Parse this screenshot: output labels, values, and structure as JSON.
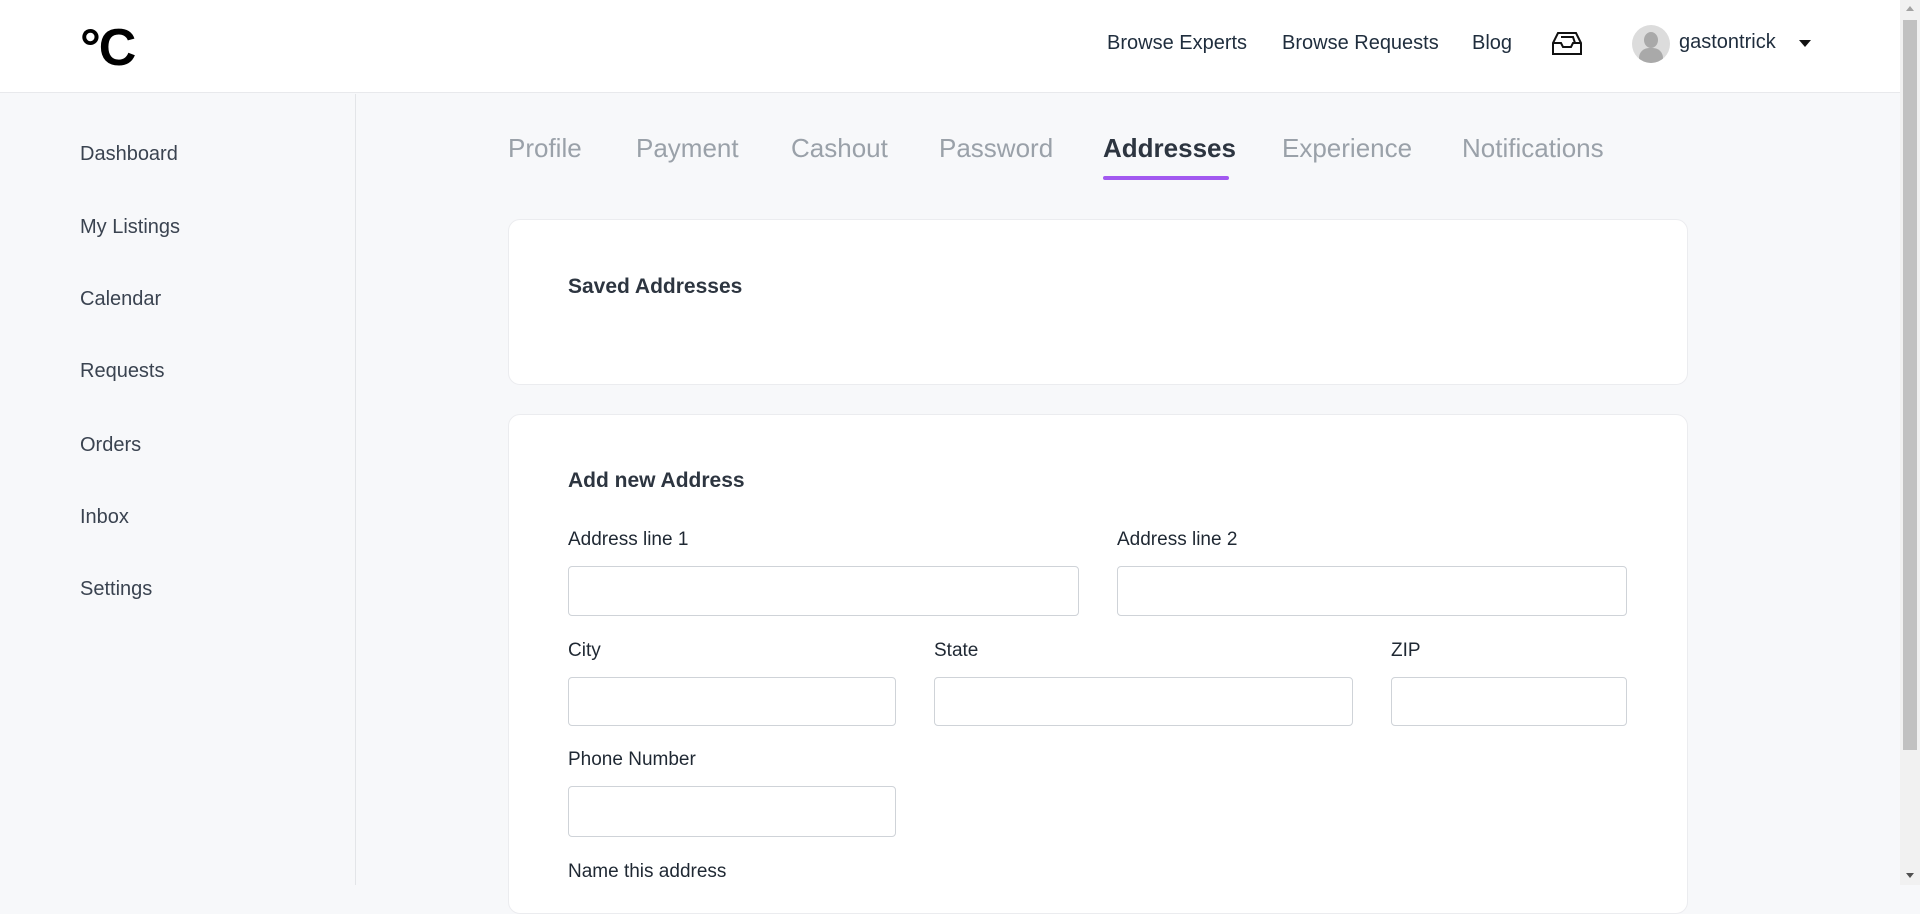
{
  "header": {
    "logo": "°C",
    "nav": [
      "Browse Experts",
      "Browse Requests",
      "Blog"
    ],
    "username": "gastontrick"
  },
  "sidebar": {
    "items": [
      "Dashboard",
      "My Listings",
      "Calendar",
      "Requests",
      "Orders",
      "Inbox",
      "Settings"
    ]
  },
  "tabs": {
    "items": [
      "Profile",
      "Payment",
      "Cashout",
      "Password",
      "Addresses",
      "Experience",
      "Notifications"
    ],
    "active": "Addresses"
  },
  "saved": {
    "title": "Saved Addresses"
  },
  "form": {
    "title": "Add new Address",
    "address1": "Address line 1",
    "address2": "Address line 2",
    "city": "City",
    "state": "State",
    "zip": "ZIP",
    "phone": "Phone Number",
    "name": "Name this address"
  },
  "colors": {
    "accent": "#a259f0"
  }
}
